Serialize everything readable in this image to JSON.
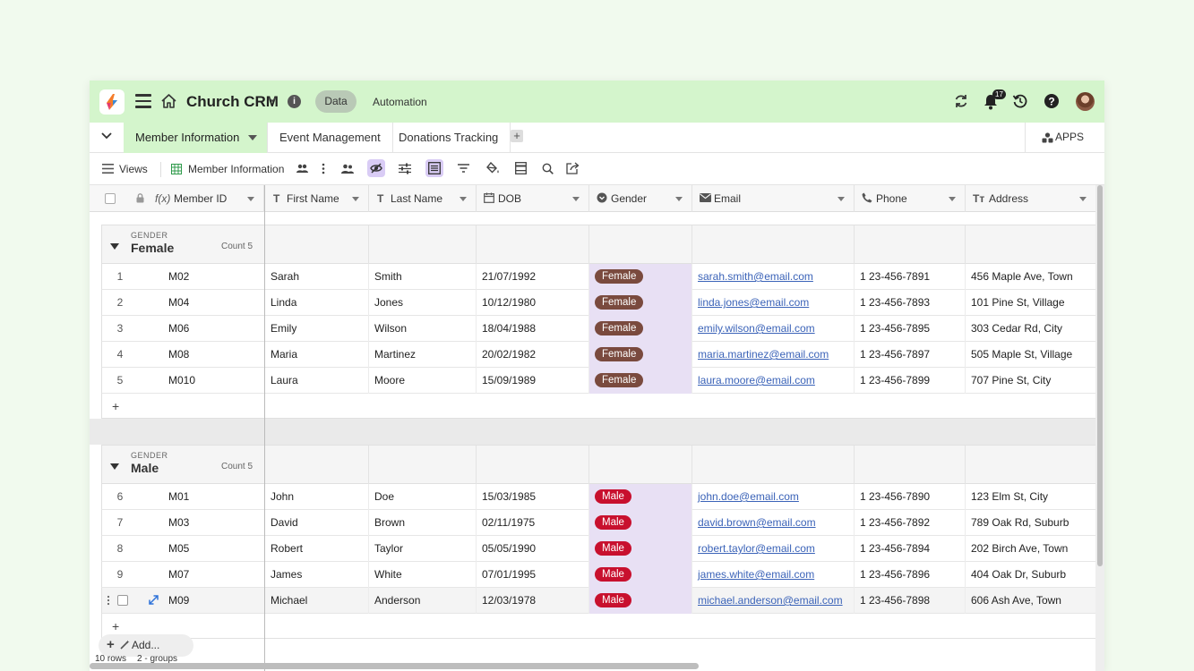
{
  "app": {
    "title": "Church CRM",
    "data_label": "Data",
    "automation_label": "Automation",
    "notification_count": "17"
  },
  "tabs": [
    {
      "label": "Member Information",
      "active": true
    },
    {
      "label": "Event Management",
      "active": false
    },
    {
      "label": "Donations Tracking",
      "active": false
    }
  ],
  "tab_add_label": "+",
  "apps_label": "APPS",
  "toolbar": {
    "views_label": "Views",
    "view_name": "Member Information"
  },
  "columns": {
    "member_id": "Member ID",
    "first_name": "First Name",
    "last_name": "Last Name",
    "dob": "DOB",
    "gender": "Gender",
    "email": "Email",
    "phone": "Phone",
    "address": "Address"
  },
  "groups": [
    {
      "field_label": "GENDER",
      "name": "Female",
      "count_label": "Count 5",
      "rows": [
        {
          "index": "1",
          "member_id": "M02",
          "first_name": "Sarah",
          "last_name": "Smith",
          "dob": "21/07/1992",
          "gender": "Female",
          "email": "sarah.smith@email.com",
          "phone": "1 23-456-7891",
          "address": "456 Maple Ave, Town"
        },
        {
          "index": "2",
          "member_id": "M04",
          "first_name": "Linda",
          "last_name": "Jones",
          "dob": "10/12/1980",
          "gender": "Female",
          "email": "linda.jones@email.com",
          "phone": "1 23-456-7893",
          "address": "101 Pine St, Village"
        },
        {
          "index": "3",
          "member_id": "M06",
          "first_name": "Emily",
          "last_name": "Wilson",
          "dob": "18/04/1988",
          "gender": "Female",
          "email": "emily.wilson@email.com",
          "phone": "1 23-456-7895",
          "address": "303 Cedar Rd, City"
        },
        {
          "index": "4",
          "member_id": "M08",
          "first_name": "Maria",
          "last_name": "Martinez",
          "dob": "20/02/1982",
          "gender": "Female",
          "email": "maria.martinez@email.com",
          "phone": "1 23-456-7897",
          "address": "505 Maple St, Village"
        },
        {
          "index": "5",
          "member_id": "M010",
          "first_name": "Laura",
          "last_name": "Moore",
          "dob": "15/09/1989",
          "gender": "Female",
          "email": "laura.moore@email.com",
          "phone": "1 23-456-7899",
          "address": "707 Pine St, City"
        }
      ]
    },
    {
      "field_label": "GENDER",
      "name": "Male",
      "count_label": "Count 5",
      "rows": [
        {
          "index": "6",
          "member_id": "M01",
          "first_name": "John",
          "last_name": "Doe",
          "dob": "15/03/1985",
          "gender": "Male",
          "email": "john.doe@email.com",
          "phone": "1 23-456-7890",
          "address": "123 Elm St, City"
        },
        {
          "index": "7",
          "member_id": "M03",
          "first_name": "David",
          "last_name": "Brown",
          "dob": "02/11/1975",
          "gender": "Male",
          "email": "david.brown@email.com",
          "phone": "1 23-456-7892",
          "address": "789 Oak Rd, Suburb"
        },
        {
          "index": "8",
          "member_id": "M05",
          "first_name": "Robert",
          "last_name": "Taylor",
          "dob": "05/05/1990",
          "gender": "Male",
          "email": "robert.taylor@email.com",
          "phone": "1 23-456-7894",
          "address": "202 Birch Ave, Town"
        },
        {
          "index": "9",
          "member_id": "M07",
          "first_name": "James",
          "last_name": "White",
          "dob": "07/01/1995",
          "gender": "Male",
          "email": "james.white@email.com",
          "phone": "1 23-456-7896",
          "address": "404 Oak Dr, Suburb"
        },
        {
          "index": "",
          "member_id": "M09",
          "first_name": "Michael",
          "last_name": "Anderson",
          "dob": "12/03/1978",
          "gender": "Male",
          "email": "michael.anderson@email.com",
          "phone": "1 23-456-7898",
          "address": "606 Ash Ave, Town"
        }
      ]
    }
  ],
  "add_label": "Add...",
  "footer": {
    "rows_label": "10 rows",
    "groups_label": "2 - groups"
  },
  "colors": {
    "header_bg": "#d4f5cc",
    "female_pill": "#7a4a3e",
    "male_pill": "#c8102e",
    "gender_column_bg": "#e8e0f4",
    "link": "#3b63b8"
  },
  "icons": [
    "logo-icon",
    "menu-icon",
    "home-icon",
    "chevron-down-icon",
    "info-icon",
    "refresh-icon",
    "bell-icon",
    "history-icon",
    "help-icon",
    "apps-icon",
    "grid-icon",
    "people-icon",
    "hide-icon",
    "settings-sliders-icon",
    "row-height-icon",
    "filter-icon",
    "paint-icon",
    "summary-icon",
    "search-icon",
    "share-icon"
  ]
}
